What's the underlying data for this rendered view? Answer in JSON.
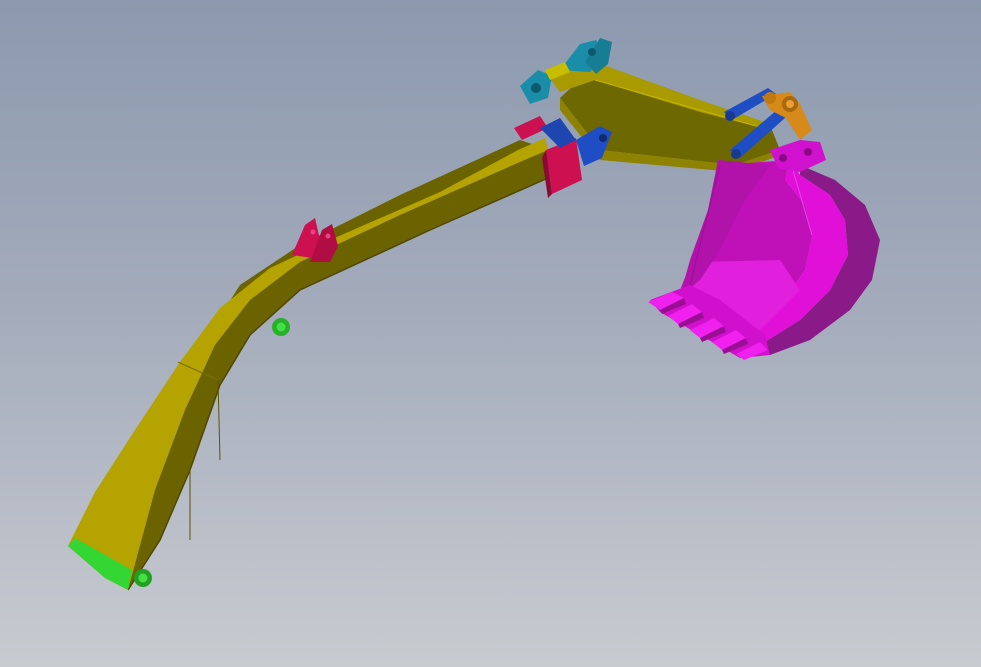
{
  "scene": {
    "colors": {
      "background_top": "#8c99ae",
      "background_bottom": "#c8cbd0",
      "boom": "#b4a300",
      "boom_shade": "#6b6200",
      "stick": "#a89a00",
      "stick_shade": "#6e6800",
      "bucket": "#e010d8",
      "bucket_shade": "#8a1a88",
      "brackets": "#cc1050",
      "link_plates": "#1f4ec4",
      "top_ears": "#1a8ea8",
      "pivot_pins": "#33d633",
      "bucket_link": "#d68a1a"
    }
  }
}
